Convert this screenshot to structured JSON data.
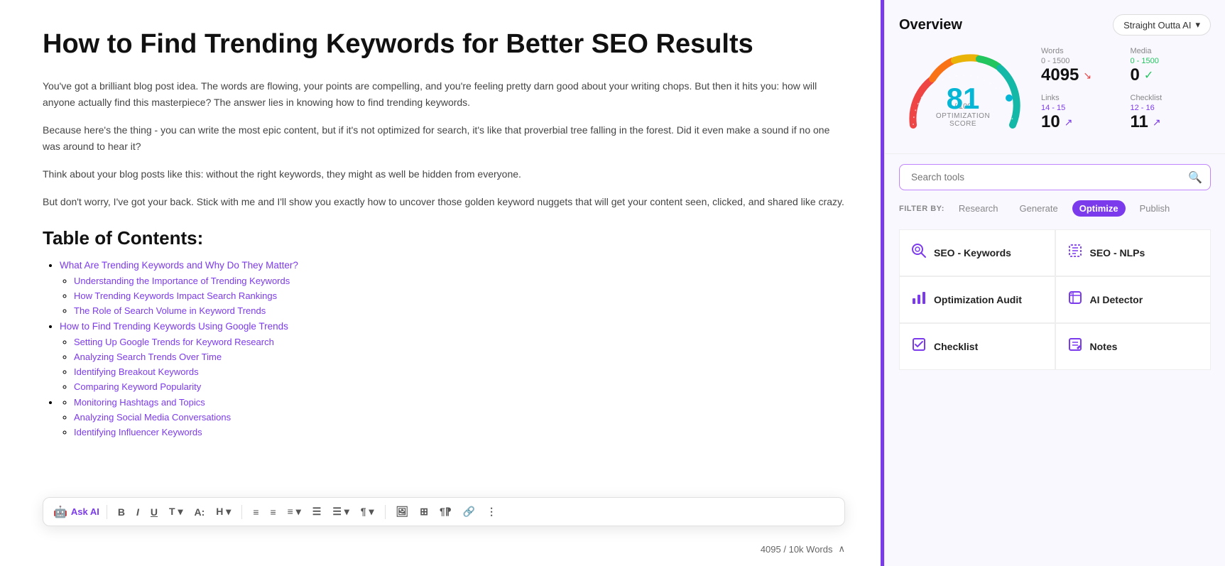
{
  "editor": {
    "title": "How to Find Trending Keywords for Better SEO Results",
    "paragraphs": [
      "You've got a brilliant blog post idea. The words are flowing, your points are compelling, and you're feeling pretty darn good about your writing chops. But then it hits you: how will anyone actually find this masterpiece? The answer lies in knowing how to find trending keywords.",
      "Because here's the thing - you can write the most epic content, but if it's not optimized for search, it's like that proverbial tree falling in the forest. Did it even make a sound if no one was around to hear it?",
      "Think about your blog posts like this: without the right keywords, they might as well be hidden from everyone.",
      "But don't worry, I've got your back. Stick with me and I'll show you exactly how to uncover those golden keyword nuggets that will get your content seen, clicked, and shared like crazy."
    ],
    "toc_title": "Table of Contents:",
    "toc_items": [
      {
        "text": "What Are Trending Keywords and Why Do They Matter?",
        "subitems": [
          "Understanding the Importance of Trending Keywords",
          "How Trending Keywords Impact Search Rankings",
          "The Role of Search Volume in Keyword Trends"
        ]
      },
      {
        "text": "How to Find Trending Keywords Using Google Trends",
        "subitems": [
          "Setting Up Google Trends for Keyword Research",
          "Analyzing Search Trends Over Time",
          "Identifying Breakout Keywords",
          "Comparing Keyword Popularity"
        ]
      }
    ],
    "more_items": [
      "Monitoring Hashtags and Topics",
      "Analyzing Social Media Conversations",
      "Identifying Influencer Keywords"
    ],
    "word_count": "4095 / 10k Words"
  },
  "toolbar": {
    "ask_ai_label": "Ask AI",
    "buttons": [
      "B",
      "I",
      "U",
      "T▾",
      "A:",
      "H▾",
      "≡",
      "≡",
      "≡▾",
      "☰",
      "☰▾",
      "¶▾",
      "⊟",
      "⊞",
      "¶⁋",
      "🔗",
      "⋮"
    ]
  },
  "sidebar": {
    "title": "Overview",
    "brand": "Straight Outta AI",
    "gauge": {
      "score": 81,
      "max": 100,
      "label": "OPTIMIZATION SCORE"
    },
    "stats": [
      {
        "label": "Words",
        "range": "0 - 1500",
        "value": "4095",
        "indicator": "arrow-down",
        "range_color": ""
      },
      {
        "label": "Media",
        "range": "0 - 1500",
        "value": "0",
        "indicator": "check",
        "range_color": "green"
      },
      {
        "label": "Links",
        "range": "14 - 15",
        "value": "10",
        "indicator": "arrow-up",
        "range_color": "purple"
      },
      {
        "label": "Checklist",
        "range": "12 - 16",
        "value": "11",
        "indicator": "arrow-up",
        "range_color": "purple"
      }
    ],
    "search_placeholder": "Search tools",
    "filter_label": "FILTER BY:",
    "filters": [
      {
        "label": "Research",
        "active": false
      },
      {
        "label": "Generate",
        "active": false
      },
      {
        "label": "Optimize",
        "active": true
      },
      {
        "label": "Publish",
        "active": false
      }
    ],
    "tools": [
      {
        "icon": "🔍",
        "label": "SEO - Keywords"
      },
      {
        "icon": "⊡",
        "label": "SEO - NLPs"
      },
      {
        "icon": "📊",
        "label": "Optimization Audit"
      },
      {
        "icon": "🤖",
        "label": "AI Detector"
      },
      {
        "icon": "✅",
        "label": "Checklist"
      },
      {
        "icon": "✏️",
        "label": "Notes"
      }
    ]
  }
}
